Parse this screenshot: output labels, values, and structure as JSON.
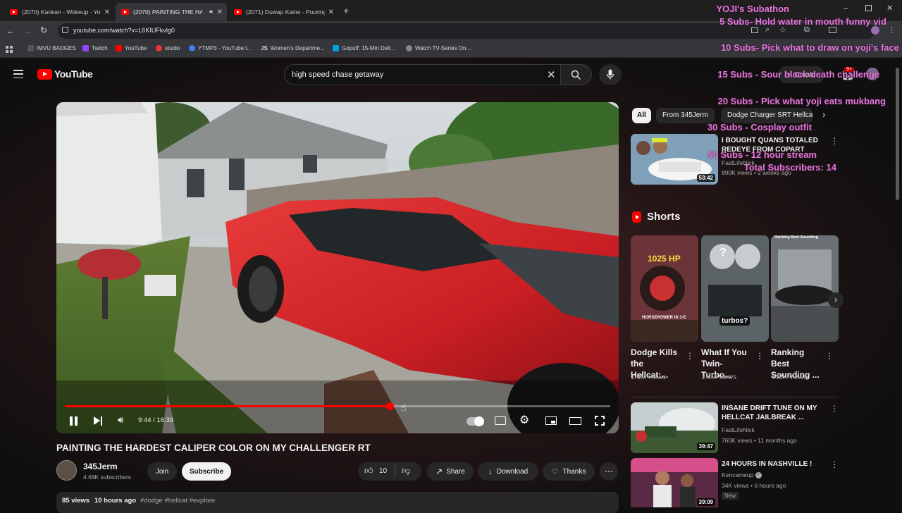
{
  "browser": {
    "tabs": [
      {
        "title": "(2070) Kankan - Wokeup - You"
      },
      {
        "title": "(2070) PAINTING THE HAR"
      },
      {
        "title": "(2071) Duwap Kaine - Pouring"
      }
    ],
    "url": "youtube.com/watch?v=L6KIUFkvlg0",
    "bookmarks": [
      "IMVU BADGES",
      "Twitch",
      "YouTube",
      "studio",
      "YTMP3 - YouTube t...",
      "Women's Departme...",
      "Gopuff: 15-Min Deli...",
      "Watch TV-Series On..."
    ]
  },
  "youtube": {
    "logo_text": "YouTube",
    "search_value": "high speed chase getaway",
    "create_label": "Create",
    "notif_count": "9+"
  },
  "player": {
    "time_current": "9:44",
    "time_total": "16:39",
    "progress": 0.595
  },
  "video": {
    "title": "PAINTING THE HARDEST CALIPER COLOR ON MY CHALLENGER RT",
    "channel": "345Jerm",
    "subscribers": "4.69K subscribers",
    "join": "Join",
    "subscribe": "Subscribe",
    "likes": "10",
    "share": "Share",
    "download": "Download",
    "thanks": "Thanks",
    "views": "85 views",
    "age": "10 hours ago",
    "tags": "#dodge #hellcat #explore"
  },
  "sidebar": {
    "chips": [
      "All",
      "From 345Jerm",
      "Dodge Charger SRT Hellca"
    ],
    "shorts_heading": "Shorts",
    "rec1": {
      "title": "I BOUGHT QUANS TOTALED REDEYE FROM COPART",
      "channel": "FastLifeNick",
      "meta": "890K views • 2 weeks ago",
      "duration": "53:42"
    },
    "shorts": [
      {
        "title": "Dodge Kills the Hellcat:...",
        "views": "1.6M views",
        "thumb_text": "1025 HP",
        "thumb_sub": "HORSEPOWER IN 1-E"
      },
      {
        "title": "What If You Twin-Turbo...",
        "views": "1.4M views",
        "thumb_text": "turbos?"
      },
      {
        "title": "Ranking Best Sounding ...",
        "views": "448K views",
        "thumb_text": "Ranking Best Sounding"
      }
    ],
    "rec2": {
      "title": "INSANE DRIFT TUNE ON MY HELLCAT JAILBREAK ...",
      "channel": "FastLifeNick",
      "meta": "760K views • 11 months ago",
      "duration": "39:47"
    },
    "rec3": {
      "title": "24 HOURS IN NASHVILLE !",
      "channel": "Kencameup",
      "meta": "34K views • 6 hours ago",
      "badge": "New",
      "duration": "39:09"
    }
  },
  "overlay": {
    "title": "YOJI's Subathon",
    "lines": [
      "5 Subs- Hold water in mouth funny vid",
      "10 Subs- Pick what to draw on yoji's face",
      "15 Subs - Sour black death challenge",
      "20 Subs - Pick what yoji eats mukbang",
      "30 Subs - Cosplay outfit",
      "50 Subs - 12 hour stream",
      "Total Subscribers: 14"
    ]
  },
  "colors": {
    "yt_red": "#ff0000",
    "overlay_pink": "#e07ad4",
    "bg": "#0f0f0f"
  }
}
